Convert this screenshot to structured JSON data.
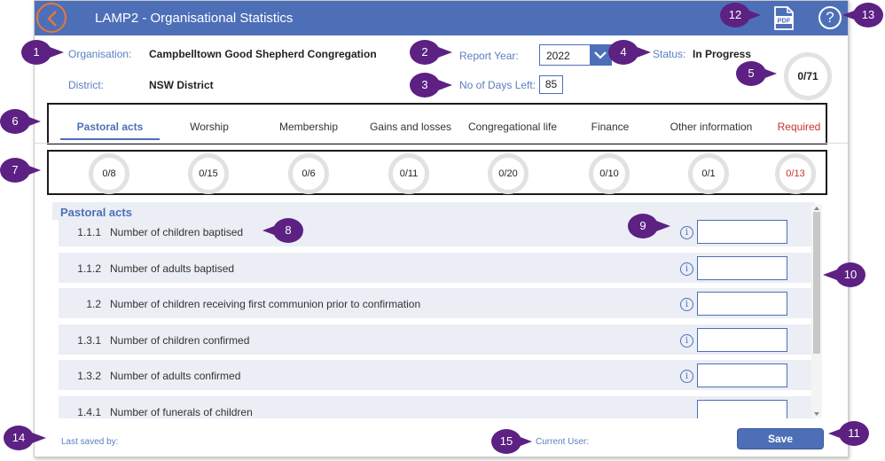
{
  "header": {
    "title": "LAMP2 - Organisational Statistics",
    "back_icon": "chevron-left-icon",
    "pdf_label": "PDF",
    "help_label": "?"
  },
  "org": {
    "org_label": "Organisation:",
    "org_value": "Campbelltown Good Shepherd Congregation",
    "district_label": "District:",
    "district_value": "NSW District"
  },
  "report": {
    "year_label": "Report Year:",
    "year_value": "2022",
    "days_label": "No of Days Left:",
    "days_value": "85",
    "status_label": "Status:",
    "status_value": "In Progress",
    "total_progress": "0/71"
  },
  "tabs": [
    {
      "label": "Pastoral acts",
      "count": "0/8"
    },
    {
      "label": "Worship",
      "count": "0/15"
    },
    {
      "label": "Membership",
      "count": "0/6"
    },
    {
      "label": "Gains and losses",
      "count": "0/11"
    },
    {
      "label": "Congregational life",
      "count": "0/20"
    },
    {
      "label": "Finance",
      "count": "0/10"
    },
    {
      "label": "Other information",
      "count": "0/1"
    },
    {
      "label": "Required",
      "count": "0/13"
    }
  ],
  "section": {
    "title": "Pastoral acts"
  },
  "rows": [
    {
      "num": "1.1.1",
      "text": "Number of children baptised",
      "info": "i",
      "value": ""
    },
    {
      "num": "1.1.2",
      "text": "Number of adults baptised",
      "info": "i",
      "value": ""
    },
    {
      "num": "1.2",
      "text": "Number of children receiving first communion prior to confirmation",
      "info": "i",
      "value": ""
    },
    {
      "num": "1.3.1",
      "text": "Number of children confirmed",
      "info": "i",
      "value": ""
    },
    {
      "num": "1.3.2",
      "text": "Number of adults confirmed",
      "info": "i",
      "value": ""
    },
    {
      "num": "1.4.1",
      "text": "Number of funerals of children",
      "info": "",
      "value": ""
    }
  ],
  "footer": {
    "last_saved_label": "Last saved by:",
    "current_user_label": "Current User:",
    "save_label": "Save"
  },
  "badges": [
    "1",
    "2",
    "3",
    "4",
    "5",
    "6",
    "7",
    "8",
    "9",
    "10",
    "11",
    "12",
    "13",
    "14",
    "15"
  ],
  "colors": {
    "header_blue": "#4d6fb8",
    "accent_orange": "#e8763a",
    "badge_purple": "#5c2183",
    "required_red": "#c7332c"
  }
}
